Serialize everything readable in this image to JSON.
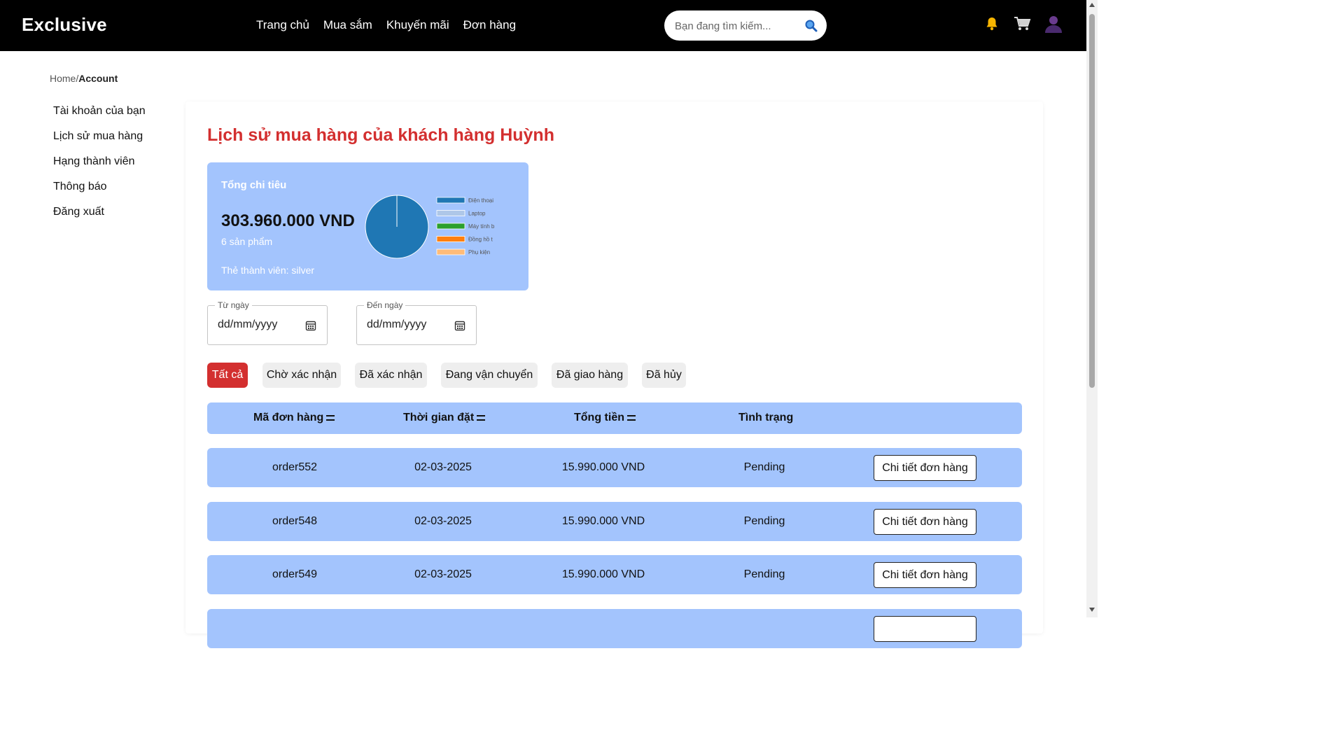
{
  "header": {
    "brand": "Exclusive",
    "nav": [
      "Trang chủ",
      "Mua sắm",
      "Khuyến mãi",
      "Đơn hàng"
    ],
    "search_placeholder": "Bạn đang tìm kiếm..."
  },
  "breadcrumb": {
    "home": "Home/",
    "current": "Account"
  },
  "sidebar": {
    "items": [
      {
        "label": "Tài khoản của bạn"
      },
      {
        "label": "Lịch sử mua hàng"
      },
      {
        "label": "Hạng thành viên"
      },
      {
        "label": "Thông báo"
      },
      {
        "label": "Đăng xuất"
      }
    ]
  },
  "main": {
    "title": "Lịch sử mua hàng của khách hàng Huỳnh",
    "summary": {
      "label": "Tổng chi tiêu",
      "amount": "303.960.000 VND",
      "count": "6 sản phẩm",
      "tier": "Thẻ thành viên: silver"
    },
    "filters": {
      "from_label": "Từ ngày",
      "from_value": "dd/mm/yyyy",
      "to_label": "Đến ngày",
      "to_value": "dd/mm/yyyy"
    },
    "tabs": [
      "Tất cả",
      "Chờ xác nhận",
      "Đã xác nhận",
      "Đang vận chuyển",
      "Đã giao hàng",
      "Đã hủy"
    ],
    "active_tab": "Tất cả",
    "table": {
      "headers": [
        "Mã đơn hàng",
        "Thời gian đặt",
        "Tổng tiền",
        "Tình trạng"
      ],
      "rows": [
        {
          "id": "order552",
          "date": "02-03-2025",
          "total": "15.990.000 VND",
          "status": "Pending",
          "action": "Chi tiết đơn hàng"
        },
        {
          "id": "order548",
          "date": "02-03-2025",
          "total": "15.990.000 VND",
          "status": "Pending",
          "action": "Chi tiết đơn hàng"
        },
        {
          "id": "order549",
          "date": "02-03-2025",
          "total": "15.990.000 VND",
          "status": "Pending",
          "action": "Chi tiết đơn hàng"
        }
      ]
    }
  },
  "chart_data": {
    "type": "pie",
    "categories": [
      "Điện thoại",
      "Laptop",
      "Máy tính b",
      "Đồng hồ t",
      "Phụ kiện"
    ],
    "values": [
      100,
      0,
      0,
      0,
      0
    ],
    "colors": [
      "#1f77b4",
      "#aec7e8",
      "#2ca02c",
      "#ff7f0e",
      "#ffbb78"
    ],
    "legend": "right"
  },
  "colors": {
    "accent": "#d32f2f",
    "card": "#a3c4fd",
    "header": "#000000"
  }
}
